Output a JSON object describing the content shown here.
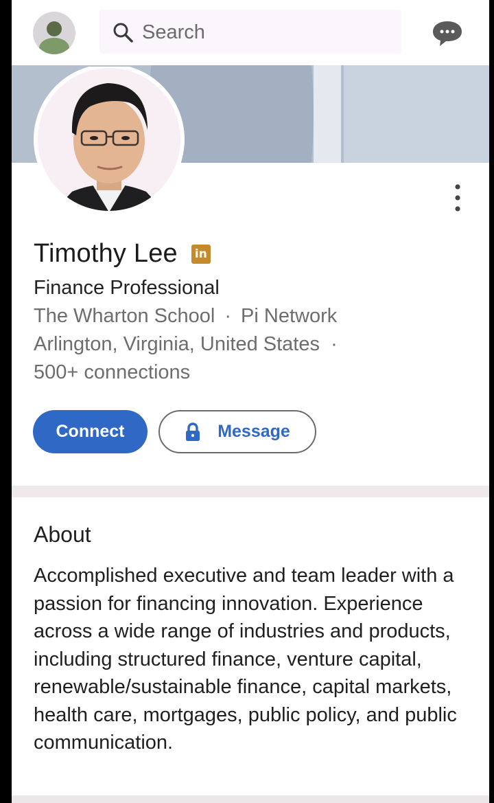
{
  "search": {
    "placeholder": "Search"
  },
  "icons": {
    "search": "search-icon",
    "messaging": "messaging-icon",
    "more": "more-vertical-icon",
    "lock": "lock-icon",
    "linkedin_badge": "linkedin-icon"
  },
  "colors": {
    "accent_blue": "#2f68c5",
    "badge_gold": "#c48a2c",
    "banner": "#b4bfcd"
  },
  "profile": {
    "name": "Timothy Lee",
    "badge_text": "in",
    "headline": "Finance Professional",
    "education": "The Wharton School",
    "separator": "·",
    "company": "Pi Network",
    "location": "Arlington, Virginia, United States",
    "location_separator": "·",
    "connections": "500+ connections"
  },
  "actions": {
    "connect_label": "Connect",
    "message_label": "Message"
  },
  "about": {
    "title": "About",
    "text": "Accomplished executive and team leader with a passion for financing innovation. Experience across a wide range of industries and products, including structured finance, venture capital, renewable/sustainable finance, capital markets, health care, mortgages, public policy, and public communication."
  }
}
